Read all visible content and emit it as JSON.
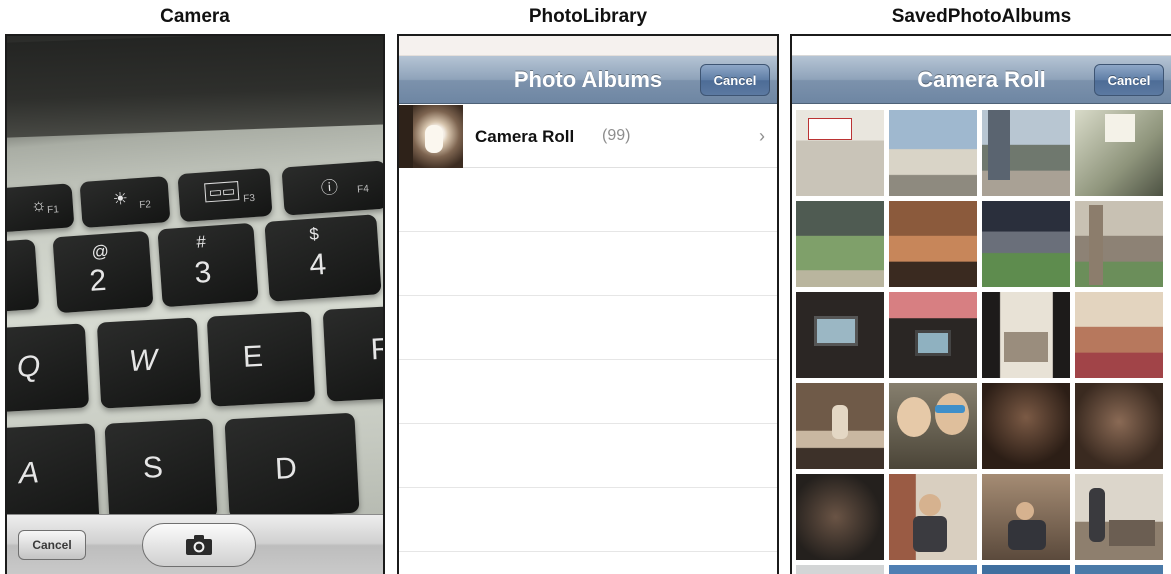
{
  "panels": {
    "camera": {
      "title": "Camera"
    },
    "library": {
      "title": "PhotoLibrary"
    },
    "saved": {
      "title": "SavedPhotoAlbums"
    }
  },
  "camera": {
    "keys": {
      "f1": "F1",
      "f2": "F2",
      "f3": "F3",
      "f4": "F4",
      "k2_sym": "@",
      "k2": "2",
      "k3_sym": "#",
      "k3": "3",
      "k4_sym": "$",
      "k4": "4",
      "q": "Q",
      "w": "W",
      "e": "E",
      "r": "R",
      "a": "A",
      "s": "S",
      "d": "D"
    },
    "toolbar": {
      "cancel_label": "Cancel",
      "shutter_icon": "camera-icon"
    }
  },
  "library": {
    "nav": {
      "title": "Photo Albums",
      "cancel_label": "Cancel"
    },
    "albums": [
      {
        "name": "Camera Roll",
        "count": "(99)"
      }
    ]
  },
  "saved": {
    "nav": {
      "title": "Camera Roll",
      "cancel_label": "Cancel"
    }
  },
  "colors": {
    "navbar_top": "#b5c4d4",
    "navbar_bottom": "#6e86a3",
    "nav_button": "#5b79a1",
    "count_gray": "#8d8d8d"
  }
}
